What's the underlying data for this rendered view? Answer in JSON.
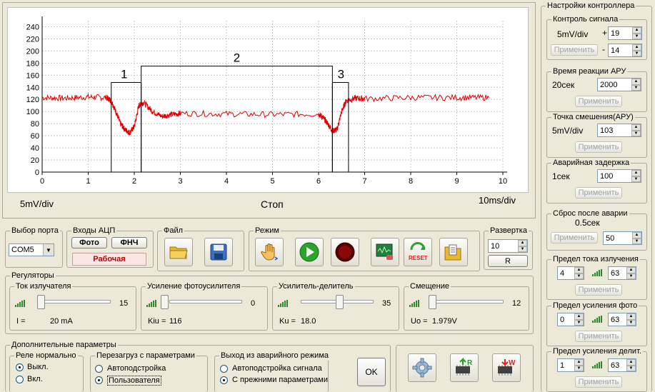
{
  "chart": {
    "left_label": "5mV/div",
    "right_label": "10ms/div",
    "status": "Стоп",
    "yticks": [
      "240",
      "220",
      "200",
      "180",
      "160",
      "140",
      "120",
      "100",
      "80",
      "60",
      "40",
      "20",
      "0"
    ],
    "xticks": [
      "0",
      "1",
      "2",
      "3",
      "4",
      "5",
      "6",
      "7",
      "8",
      "9",
      "10"
    ],
    "region_labels": [
      "1",
      "2",
      "3"
    ]
  },
  "chart_data": {
    "type": "line",
    "xlim": [
      0,
      10
    ],
    "ylim": [
      0,
      250
    ],
    "series": [
      {
        "x": [
          0,
          0.5,
          1.0,
          1.4,
          1.5,
          1.6,
          1.7,
          1.8,
          1.9,
          2.0,
          2.1,
          2.2,
          2.4,
          2.6,
          2.8,
          3.0,
          4.0,
          5.0,
          6.0,
          6.1,
          6.2,
          6.3,
          6.4,
          6.5,
          6.6,
          6.8,
          7.0,
          8.0,
          9.0,
          9.7
        ],
        "y": [
          123,
          122,
          124,
          123,
          118,
          100,
          80,
          70,
          65,
          75,
          110,
          115,
          100,
          92,
          95,
          97,
          96,
          95,
          96,
          90,
          80,
          68,
          70,
          100,
          118,
          122,
          121,
          123,
          123,
          123
        ]
      }
    ],
    "regions": [
      {
        "label": "1",
        "x0": 1.5,
        "x1": 2.15,
        "top": 148
      },
      {
        "label": "2",
        "x0": 2.15,
        "x1": 6.3,
        "top": 175
      },
      {
        "label": "3",
        "x0": 6.3,
        "x1": 6.65,
        "top": 148
      }
    ]
  },
  "port": {
    "title": "Выбор порта",
    "value": "COM5"
  },
  "adc": {
    "title": "Входы АЦП",
    "foto": "Фото",
    "fnch": "ФНЧ",
    "status": "Рабочая"
  },
  "file": {
    "title": "Файл"
  },
  "mode": {
    "title": "Режим"
  },
  "sweep": {
    "title": "Развертка",
    "value": "10",
    "reset": "R"
  },
  "regulators": {
    "title": "Регуляторы",
    "items": [
      {
        "title": "Ток излучателя",
        "value": "15",
        "info_label": "I =",
        "info_value": "20 mA"
      },
      {
        "title": "Усиление фотоусилителя",
        "value": "0",
        "info_label": "Kiu =",
        "info_value": "116"
      },
      {
        "title": "Усилитель-делитель",
        "value": "35",
        "info_label": "Ku =",
        "info_value": "18.0"
      },
      {
        "title": "Смещение",
        "value": "12",
        "info_label": "Uo =",
        "info_value": "1.979V"
      }
    ]
  },
  "extra": {
    "title": "Дополнительные параметры",
    "relay": {
      "title": "Реле нормально",
      "options": [
        "Выкл.",
        "Вкл."
      ],
      "selected": 0
    },
    "reload": {
      "title": "Перезагруз с параметрами",
      "options": [
        "Автоподстройка",
        "Пользователя"
      ],
      "selected": 1
    },
    "exit": {
      "title": "Выход из аварийного режима",
      "options": [
        "Автоподстройка  сигнала",
        "С прежними параметрами"
      ],
      "selected": 1
    },
    "ok": "OK"
  },
  "controller": {
    "title": "Настройки контроллера",
    "signal": {
      "title": "Контроль сигнала",
      "unit": "5mV/div",
      "plus": "+",
      "minus": "-",
      "top": "19",
      "bottom": "14",
      "apply": "Применить"
    },
    "agc_time": {
      "title": "Время реакции АРУ",
      "unit": "20сек",
      "value": "2000",
      "apply": "Применить"
    },
    "agc_offset": {
      "title": "Точка смешения(АРУ)",
      "unit": "5mV/div",
      "value": "103",
      "apply": "Применить"
    },
    "alarm_delay": {
      "title": "Аварийная задержка",
      "unit": "1сек",
      "value": "100",
      "apply": "Применить"
    },
    "alarm_reset": {
      "title": "Сброс после аварии",
      "unit": "0.5сек",
      "value": "50",
      "apply": "Применить"
    },
    "emit_limit": {
      "title": "Предел тока излучения",
      "a": "4",
      "b": "63",
      "apply": "Применить"
    },
    "photo_limit": {
      "title": "Предел усиления фото",
      "a": "0",
      "b": "63",
      "apply": "Применить"
    },
    "div_limit": {
      "title": "Предел усиления делит.",
      "a": "1",
      "b": "63",
      "apply": "Применить"
    }
  },
  "colors": {
    "signal": "#e00000",
    "grid": "#c8c8c8"
  }
}
